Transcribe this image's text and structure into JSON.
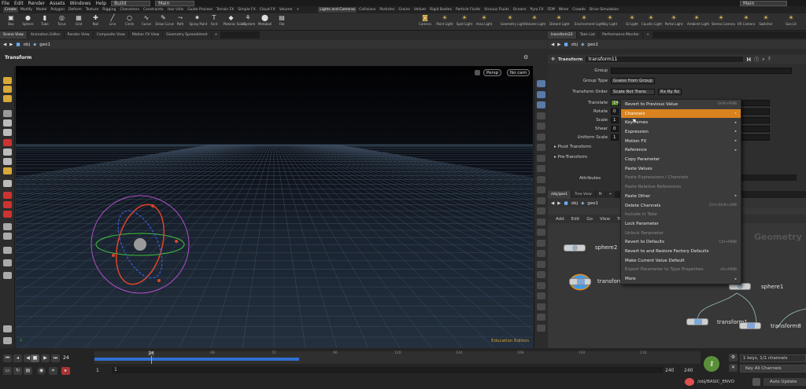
{
  "menubar": {
    "items": [
      "File",
      "Edit",
      "Render",
      "Assets",
      "Windows",
      "Help"
    ],
    "build_desktop": "Build",
    "main_desktop": "Main",
    "main_desktop2": "Main"
  },
  "shelf_tabs_left": [
    "Create",
    "Modify",
    "Model",
    "Polygon",
    "Deform",
    "Texture",
    "Rigging",
    "Characters",
    "Constraints",
    "Hair Utils",
    "Guide Process",
    "Terrain FX",
    "Simple FX",
    "Cloud FX",
    "Volume"
  ],
  "shelf_tabs_right": [
    "Lights and Cameras",
    "Collisions",
    "Particles",
    "Grains",
    "Vellum",
    "Rigid Bodies",
    "Particle Fluids",
    "Viscous Fluids",
    "Oceans",
    "Pyro FX",
    "FEM",
    "Wires",
    "Crowds",
    "Drive Simulation"
  ],
  "tools_left": [
    {
      "label": "Box",
      "icon": "box-icon"
    },
    {
      "label": "Sphere",
      "icon": "sphere-icon"
    },
    {
      "label": "Tube",
      "icon": "tube-icon"
    },
    {
      "label": "Torus",
      "icon": "torus-icon"
    },
    {
      "label": "Grid",
      "icon": "grid-icon"
    },
    {
      "label": "Null",
      "icon": "null-icon"
    },
    {
      "label": "Line",
      "icon": "line-icon"
    },
    {
      "label": "Circle",
      "icon": "circle-icon"
    },
    {
      "label": "Curve",
      "icon": "curve-icon"
    },
    {
      "label": "Draw Curve",
      "icon": "draw-curve-icon"
    },
    {
      "label": "Path",
      "icon": "path-icon"
    },
    {
      "label": "Spray Paint",
      "icon": "spray-paint-icon"
    },
    {
      "label": "Font",
      "icon": "font-icon"
    },
    {
      "label": "Platonic Solids",
      "icon": "platonic-icon"
    },
    {
      "label": "L-System",
      "icon": "lsystem-icon"
    },
    {
      "label": "Metaball",
      "icon": "metaball-icon"
    },
    {
      "label": "File",
      "icon": "file-icon"
    }
  ],
  "tools_right": [
    {
      "label": "Camera"
    },
    {
      "label": "Point Light"
    },
    {
      "label": "Spot Light"
    },
    {
      "label": "Area Light"
    },
    {
      "label": "Geometry Light"
    },
    {
      "label": "Volume Light"
    },
    {
      "label": "Distant Light"
    },
    {
      "label": "Environment Light"
    },
    {
      "label": "Sky Light"
    },
    {
      "label": "GI Light"
    },
    {
      "label": "Caustic Light"
    },
    {
      "label": "Portal Light"
    },
    {
      "label": "Ambient Light"
    },
    {
      "label": "Stereo Camera"
    },
    {
      "label": "VR Camera"
    },
    {
      "label": "Switcher"
    },
    {
      "label": "Gas Lit"
    }
  ],
  "pane_tabs_left": [
    "Scene View",
    "Animation Editor",
    "Render View",
    "Composite View",
    "Motion FX View",
    "Geometry Spreadsheet"
  ],
  "pane_tabs_right": [
    "transform22",
    "Take List",
    "Performance Monitor"
  ],
  "viewer": {
    "path_obj": "obj",
    "path_geo": "geo1",
    "tool_title": "Transform",
    "persp": "Persp",
    "camera": "No cam",
    "edition": "Education Edition"
  },
  "parm": {
    "node_type": "Transform",
    "node_name": "transform11",
    "rows": [
      {
        "label": "Group",
        "value": ""
      },
      {
        "label": "Group Type",
        "value": "Guess from Group"
      },
      {
        "label": "Transform Order",
        "value": "Scale Rot Trans",
        "value2": "Rx Ry Rz"
      },
      {
        "label": "Translate",
        "value": "14."
      },
      {
        "label": "Rotate",
        "value": "0"
      },
      {
        "label": "Scale",
        "value": "1"
      },
      {
        "label": "Shear",
        "value": "0"
      },
      {
        "label": "Uniform Scale",
        "value": "1"
      }
    ],
    "sections": [
      "Pivot Transform",
      "Pre-Transform"
    ],
    "attributes_label": "Attributes"
  },
  "context_menu": [
    {
      "label": "Revert to Previous Value",
      "shortcut": "Shift+RMB",
      "state": "normal"
    },
    {
      "label": "Channels",
      "shortcut": "",
      "state": "highlight",
      "sub": true
    },
    {
      "label": "Keyframes",
      "shortcut": "",
      "state": "normal",
      "sub": true
    },
    {
      "label": "Expression",
      "shortcut": "",
      "state": "normal",
      "sub": true
    },
    {
      "label": "Motion FX",
      "shortcut": "",
      "state": "normal",
      "sub": true
    },
    {
      "label": "Reference",
      "shortcut": "",
      "state": "normal",
      "sub": true
    },
    {
      "label": "Copy Parameter",
      "shortcut": "",
      "state": "normal"
    },
    {
      "label": "Paste Values",
      "shortcut": "",
      "state": "normal"
    },
    {
      "label": "Paste Expressions / Channels",
      "shortcut": "",
      "state": "disabled"
    },
    {
      "label": "Paste Relative References",
      "shortcut": "",
      "state": "disabled"
    },
    {
      "label": "Paste Other",
      "shortcut": "",
      "state": "normal",
      "sub": true
    },
    {
      "label": "Delete Channels",
      "shortcut": "Ctrl+Shift+LMB",
      "state": "normal"
    },
    {
      "label": "Include in Take",
      "shortcut": "",
      "state": "disabled"
    },
    {
      "label": "Lock Parameter",
      "shortcut": "",
      "state": "normal"
    },
    {
      "label": "Unlock Parameter",
      "shortcut": "",
      "state": "disabled"
    },
    {
      "label": "Revert to Defaults",
      "shortcut": "Ctrl+MMB",
      "state": "normal"
    },
    {
      "label": "Revert to and Restore Factory Defaults",
      "shortcut": "",
      "state": "normal"
    },
    {
      "label": "Make Current Value Default",
      "shortcut": "",
      "state": "normal"
    },
    {
      "label": "Export Parameter to Type Properties",
      "shortcut": "Alt+MMB",
      "state": "disabled"
    },
    {
      "label": "More",
      "shortcut": "",
      "state": "normal",
      "sub": true
    }
  ],
  "network": {
    "tabs": [
      "/obj/geo1",
      "Tree View",
      "M"
    ],
    "path_obj": "obj",
    "path_geo": "geo1",
    "menu": [
      "Add",
      "Edit",
      "Go",
      "View",
      "To"
    ],
    "watermark": "Geometry",
    "nodes": [
      {
        "label": "sphere2"
      },
      {
        "label": "transform"
      },
      {
        "label": "sphere1"
      },
      {
        "label": "transform1"
      },
      {
        "label": "transform8"
      }
    ]
  },
  "timeline": {
    "current_frame": "24",
    "frame_marker": "24",
    "ticks": [
      "24",
      "48",
      "72",
      "96",
      "120",
      "144",
      "168",
      "192",
      "216"
    ],
    "range_start": "1",
    "range_start2": "1",
    "range_end": "240",
    "range_end2": "240",
    "keys_info": "1 keys, 1/1 channels",
    "key_mode": "Key All Channels",
    "status_path": "/obj/BASIC_ENVO",
    "auto_update": "Auto Update"
  },
  "colors": {
    "highlight": "#d9821e",
    "accent_blue": "#2f6fd0",
    "red": "#e0442a",
    "green": "#3cc23c",
    "blue": "#3a5fd8",
    "purple": "#b04fc8"
  }
}
